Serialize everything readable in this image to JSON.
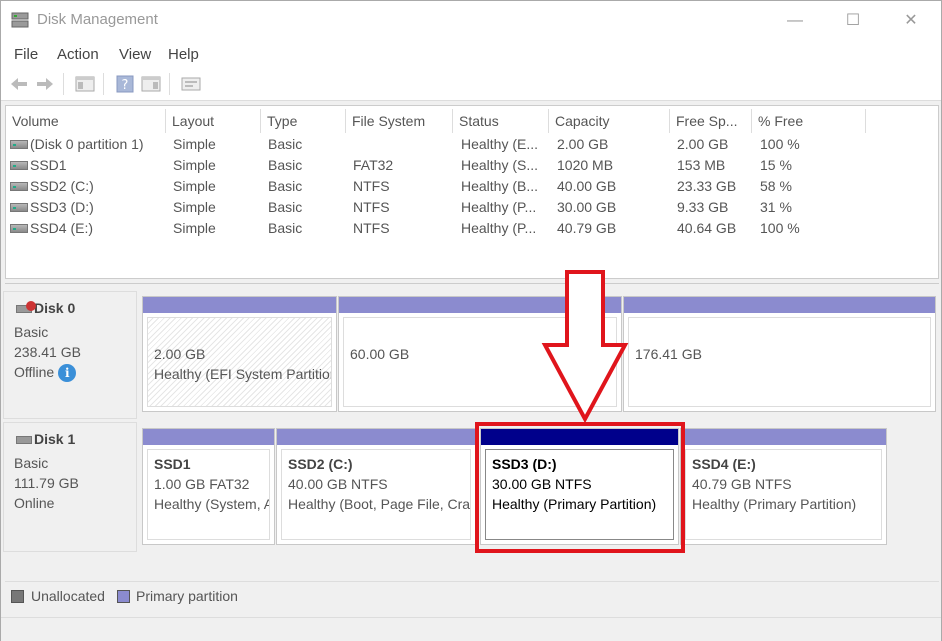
{
  "window": {
    "title": "Disk Management",
    "minimize": "—",
    "maximize": "☐",
    "close": "✕"
  },
  "menu": [
    "File",
    "Action",
    "View",
    "Help"
  ],
  "toolbar": {
    "icons": [
      "back-arrow-icon",
      "forward-arrow-icon",
      "console-tree-icon",
      "help-icon",
      "properties-icon",
      "refresh-icon"
    ]
  },
  "volume_list": {
    "columns": [
      "Volume",
      "Layout",
      "Type",
      "File System",
      "Status",
      "Capacity",
      "Free Sp...",
      "% Free"
    ],
    "rows": [
      [
        "(Disk 0 partition 1)",
        "Simple",
        "Basic",
        "",
        "Healthy (E...",
        "2.00 GB",
        "2.00 GB",
        "100 %"
      ],
      [
        "SSD1",
        "Simple",
        "Basic",
        "FAT32",
        "Healthy (S...",
        "1020 MB",
        "153 MB",
        "15 %"
      ],
      [
        "SSD2 (C:)",
        "Simple",
        "Basic",
        "NTFS",
        "Healthy (B...",
        "40.00 GB",
        "23.33 GB",
        "58 %"
      ],
      [
        "SSD3 (D:)",
        "Simple",
        "Basic",
        "NTFS",
        "Healthy (P...",
        "30.00 GB",
        "9.33 GB",
        "31 %"
      ],
      [
        "SSD4 (E:)",
        "Simple",
        "Basic",
        "NTFS",
        "Healthy (P...",
        "40.79 GB",
        "40.64 GB",
        "100 %"
      ]
    ]
  },
  "disks": {
    "disk0": {
      "name": "Disk 0",
      "type": "Basic",
      "size": "238.41 GB",
      "status": "Offline",
      "info_icon": "i",
      "partitions": [
        {
          "size": "2.00 GB",
          "status": "Healthy (EFI System Partition)"
        },
        {
          "size": "60.00 GB"
        },
        {
          "size": "176.41 GB"
        }
      ]
    },
    "disk1": {
      "name": "Disk 1",
      "type": "Basic",
      "size": "111.79 GB",
      "status": "Online",
      "partitions": [
        {
          "name": "SSD1",
          "detail": "1.00 GB FAT32",
          "status": "Healthy (System, Active, Primary Partition)"
        },
        {
          "name": "SSD2  (C:)",
          "detail": "40.00 GB NTFS",
          "status": "Healthy (Boot, Page File, Crash Dump, Primary Partition)"
        },
        {
          "name": "SSD3  (D:)",
          "detail": "30.00 GB NTFS",
          "status": "Healthy (Primary Partition)",
          "selected": true
        },
        {
          "name": "SSD4  (E:)",
          "detail": "40.79 GB NTFS",
          "status": "Healthy (Primary Partition)"
        }
      ]
    }
  },
  "legend": {
    "unallocated": "Unallocated",
    "primary": "Primary partition",
    "unallocated_color": "#777777",
    "primary_color": "#8b8bcf"
  },
  "colors": {
    "highlight": "#e0151c",
    "selected_bar": "#00008b",
    "partition_bar": "#8b8bcf"
  }
}
